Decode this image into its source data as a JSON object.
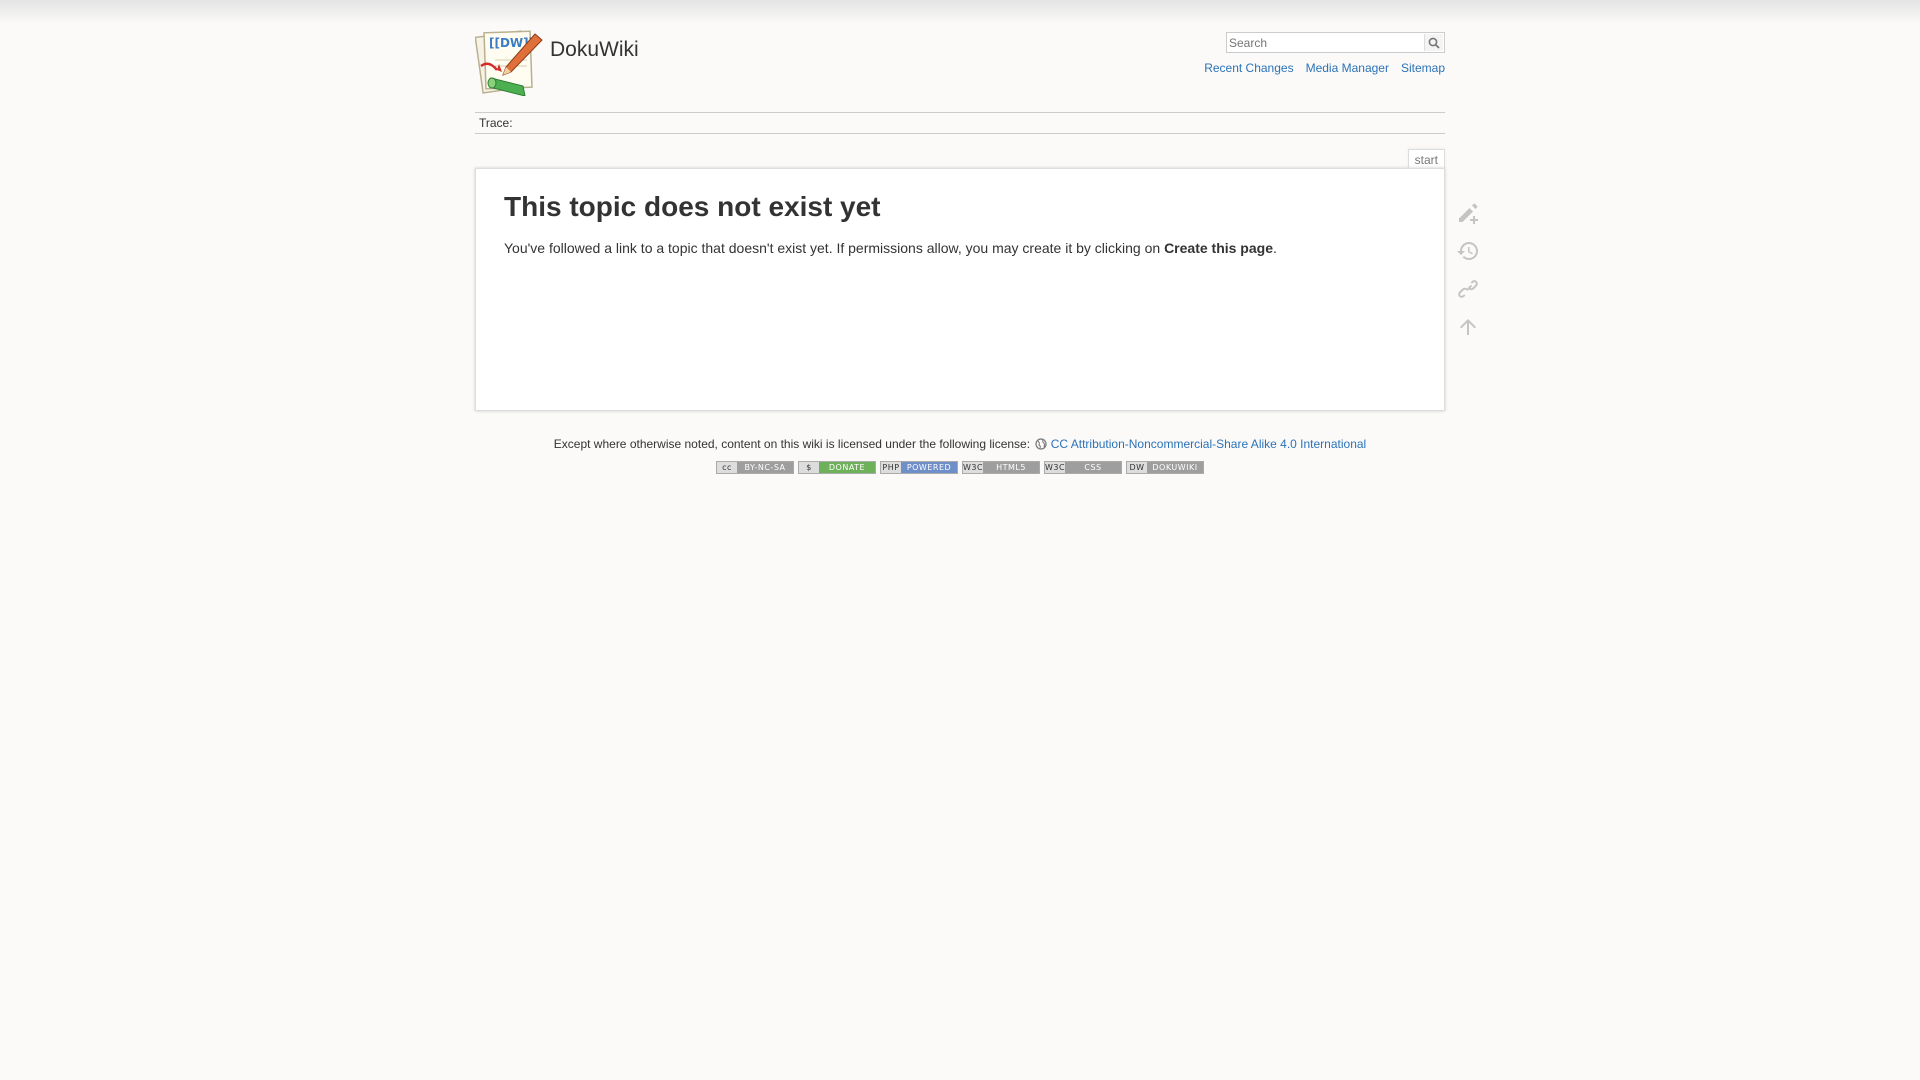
{
  "site": {
    "title": "DokuWiki"
  },
  "search": {
    "placeholder": "Search"
  },
  "tools": {
    "recent_changes": "Recent Changes",
    "media_manager": "Media Manager",
    "sitemap": "Sitemap"
  },
  "breadcrumbs": {
    "label": "Trace:"
  },
  "page": {
    "id": "start",
    "heading": "This topic does not exist yet",
    "text_before": "You've followed a link to a topic that doesn't exist yet. If permissions allow, you may create it by clicking on ",
    "text_strong": "Create this page",
    "text_after": "."
  },
  "pagetools": [
    "create-page-icon",
    "old-revisions-icon",
    "backlinks-icon",
    "back-to-top-icon"
  ],
  "footer": {
    "license_text": "Except where otherwise noted, content on this wiki is licensed under the following license:",
    "license_link": "CC Attribution-Noncommercial-Share Alike 4.0 International",
    "badges": [
      {
        "left": "cc",
        "right": "BY-NC-SA",
        "color": "#9e9e9e"
      },
      {
        "left": "$",
        "right": "DONATE",
        "color": "#6fb05a"
      },
      {
        "left": "PHP",
        "right": "POWERED",
        "color": "#6f8fc9"
      },
      {
        "left": "W3C",
        "right": "HTML5",
        "color": "#9e9e9e"
      },
      {
        "left": "W3C",
        "right": "CSS",
        "color": "#9e9e9e"
      },
      {
        "left": "DW",
        "right": "DOKUWIKI",
        "color": "#9e9e9e"
      }
    ]
  },
  "colors": {
    "link": "#2b73b7",
    "background": "#fbfaf9"
  }
}
